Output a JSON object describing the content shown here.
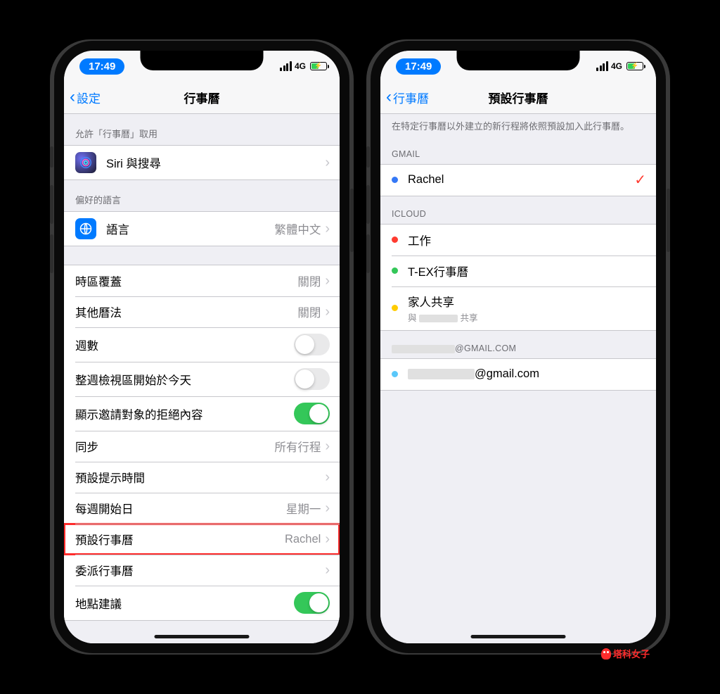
{
  "status": {
    "time": "17:49",
    "network": "4G"
  },
  "left": {
    "back_label": "設定",
    "title": "行事曆",
    "section1_header": "允許「行事曆」取用",
    "rows": {
      "siri": "Siri 與搜尋"
    },
    "section2_header": "偏好的語言",
    "language_label": "語言",
    "language_value": "繁體中文",
    "settings_rows": [
      {
        "label": "時區覆蓋",
        "detail": "關閉",
        "type": "link"
      },
      {
        "label": "其他曆法",
        "detail": "關閉",
        "type": "link"
      },
      {
        "label": "週數",
        "type": "switch",
        "on": false
      },
      {
        "label": "整週檢視區開始於今天",
        "type": "switch",
        "on": false
      },
      {
        "label": "顯示邀請對象的拒絕內容",
        "type": "switch",
        "on": true
      },
      {
        "label": "同步",
        "detail": "所有行程",
        "type": "link"
      },
      {
        "label": "預設提示時間",
        "type": "link"
      },
      {
        "label": "每週開始日",
        "detail": "星期一",
        "type": "link"
      },
      {
        "label": "預設行事曆",
        "detail": "Rachel",
        "type": "link",
        "highlight": true
      },
      {
        "label": "委派行事曆",
        "type": "link"
      },
      {
        "label": "地點建議",
        "type": "switch",
        "on": true
      }
    ]
  },
  "right": {
    "back_label": "行事曆",
    "title": "預設行事曆",
    "footer": "在特定行事曆以外建立的新行程將依照預設加入此行事曆。",
    "sections": [
      {
        "header": "GMAIL",
        "items": [
          {
            "color": "#3478f6",
            "label": "Rachel",
            "checked": true
          }
        ]
      },
      {
        "header": "ICLOUD",
        "items": [
          {
            "color": "#ff3b30",
            "label": "工作"
          },
          {
            "color": "#34c759",
            "label": "T-EX行事曆"
          },
          {
            "color": "#ffcc00",
            "label": "家人共享",
            "sub_prefix": "與",
            "sub_suffix": "共享",
            "redacted": true
          }
        ]
      },
      {
        "header_redacted": true,
        "header_suffix": "@GMAIL.COM",
        "items": [
          {
            "color": "#5ac8fa",
            "label_redacted": true,
            "label_suffix": "@gmail.com"
          }
        ]
      }
    ]
  },
  "watermark": "塔科女子"
}
